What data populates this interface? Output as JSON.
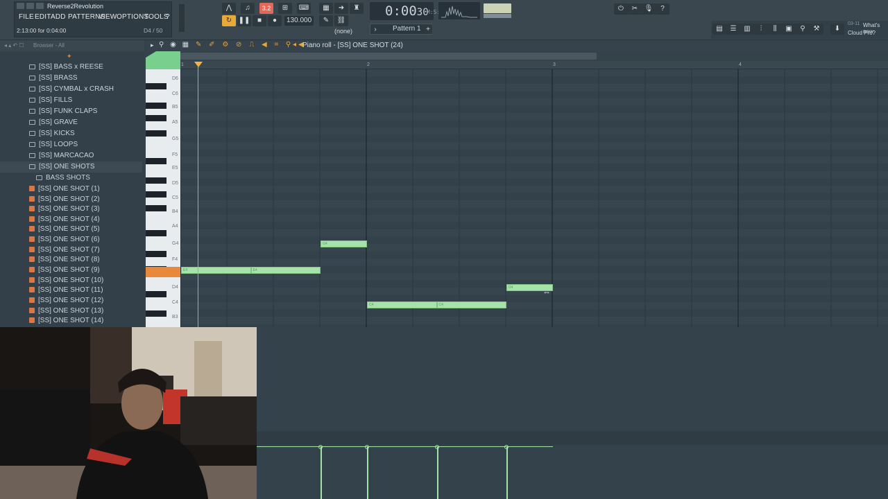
{
  "window": {
    "project_title": "Reverse2Revolution",
    "menu": [
      "FILE",
      "EDIT",
      "ADD",
      "PATTERNS",
      "VIEW",
      "OPTIONS",
      "TOOLS",
      "?"
    ],
    "hint": "2:13:00 for 0:04:00",
    "hint_right": "D4 / 50"
  },
  "transport": {
    "time": "0:00",
    "time_small": "30",
    "time_unit": "M:S:CS",
    "tempo": "130.000",
    "pattern": "Pattern 1",
    "snap": "(none)",
    "song_mode_label": "3.2"
  },
  "news": {
    "date": "03-11",
    "text": "What's new",
    "sub": "Cloud Pro?"
  },
  "browser": {
    "header": "Browser - All",
    "items": [
      {
        "label": "[SS] BASS x REESE",
        "kind": "folder"
      },
      {
        "label": "[SS] BRASS",
        "kind": "folder"
      },
      {
        "label": "[SS] CYMBAL x CRASH",
        "kind": "folder"
      },
      {
        "label": "[SS] FILLS",
        "kind": "folder"
      },
      {
        "label": "[SS] FUNK CLAPS",
        "kind": "folder"
      },
      {
        "label": "[SS] GRAVE",
        "kind": "folder"
      },
      {
        "label": "[SS] KICKS",
        "kind": "folder"
      },
      {
        "label": "[SS] LOOPS",
        "kind": "folder"
      },
      {
        "label": "[SS] MARCACAO",
        "kind": "folder"
      },
      {
        "label": "[SS] ONE SHOTS",
        "kind": "folder"
      },
      {
        "label": "BASS SHOTS",
        "kind": "subfolder"
      },
      {
        "label": "[SS] ONE SHOT (1)",
        "kind": "file"
      },
      {
        "label": "[SS] ONE SHOT (2)",
        "kind": "file"
      },
      {
        "label": "[SS] ONE SHOT (3)",
        "kind": "file"
      },
      {
        "label": "[SS] ONE SHOT (4)",
        "kind": "file"
      },
      {
        "label": "[SS] ONE SHOT (5)",
        "kind": "file"
      },
      {
        "label": "[SS] ONE SHOT (6)",
        "kind": "file"
      },
      {
        "label": "[SS] ONE SHOT (7)",
        "kind": "file"
      },
      {
        "label": "[SS] ONE SHOT (8)",
        "kind": "file"
      },
      {
        "label": "[SS] ONE SHOT (9)",
        "kind": "file"
      },
      {
        "label": "[SS] ONE SHOT (10)",
        "kind": "file"
      },
      {
        "label": "[SS] ONE SHOT (11)",
        "kind": "file"
      },
      {
        "label": "[SS] ONE SHOT (12)",
        "kind": "file"
      },
      {
        "label": "[SS] ONE SHOT (13)",
        "kind": "file"
      },
      {
        "label": "[SS] ONE SHOT (14)",
        "kind": "file"
      }
    ]
  },
  "piano_roll": {
    "title": "Piano roll - [SS] ONE SHOT (24)",
    "bars": [
      "1",
      "2",
      "3",
      "4"
    ],
    "key_labels": [
      "D6",
      "C6",
      "B5",
      "A5",
      "G5",
      "F5",
      "E5",
      "D5",
      "C5",
      "B4",
      "A4",
      "G4",
      "F4",
      "E4",
      "D4",
      "C4",
      "B3"
    ],
    "notes": [
      {
        "pitch": "E4",
        "start_bar": 1.0,
        "length_bars": 0.375,
        "label": "E4"
      },
      {
        "pitch": "E4",
        "start_bar": 1.375,
        "length_bars": 0.375,
        "label": "E4"
      },
      {
        "pitch": "G4",
        "start_bar": 1.75,
        "length_bars": 0.25,
        "label": "G4"
      },
      {
        "pitch": "C4",
        "start_bar": 2.0,
        "length_bars": 0.375,
        "label": "C4"
      },
      {
        "pitch": "C4",
        "start_bar": 2.375,
        "length_bars": 0.375,
        "label": "C4"
      },
      {
        "pitch": "D4",
        "start_bar": 2.75,
        "length_bars": 0.25,
        "label": "D4"
      }
    ]
  }
}
